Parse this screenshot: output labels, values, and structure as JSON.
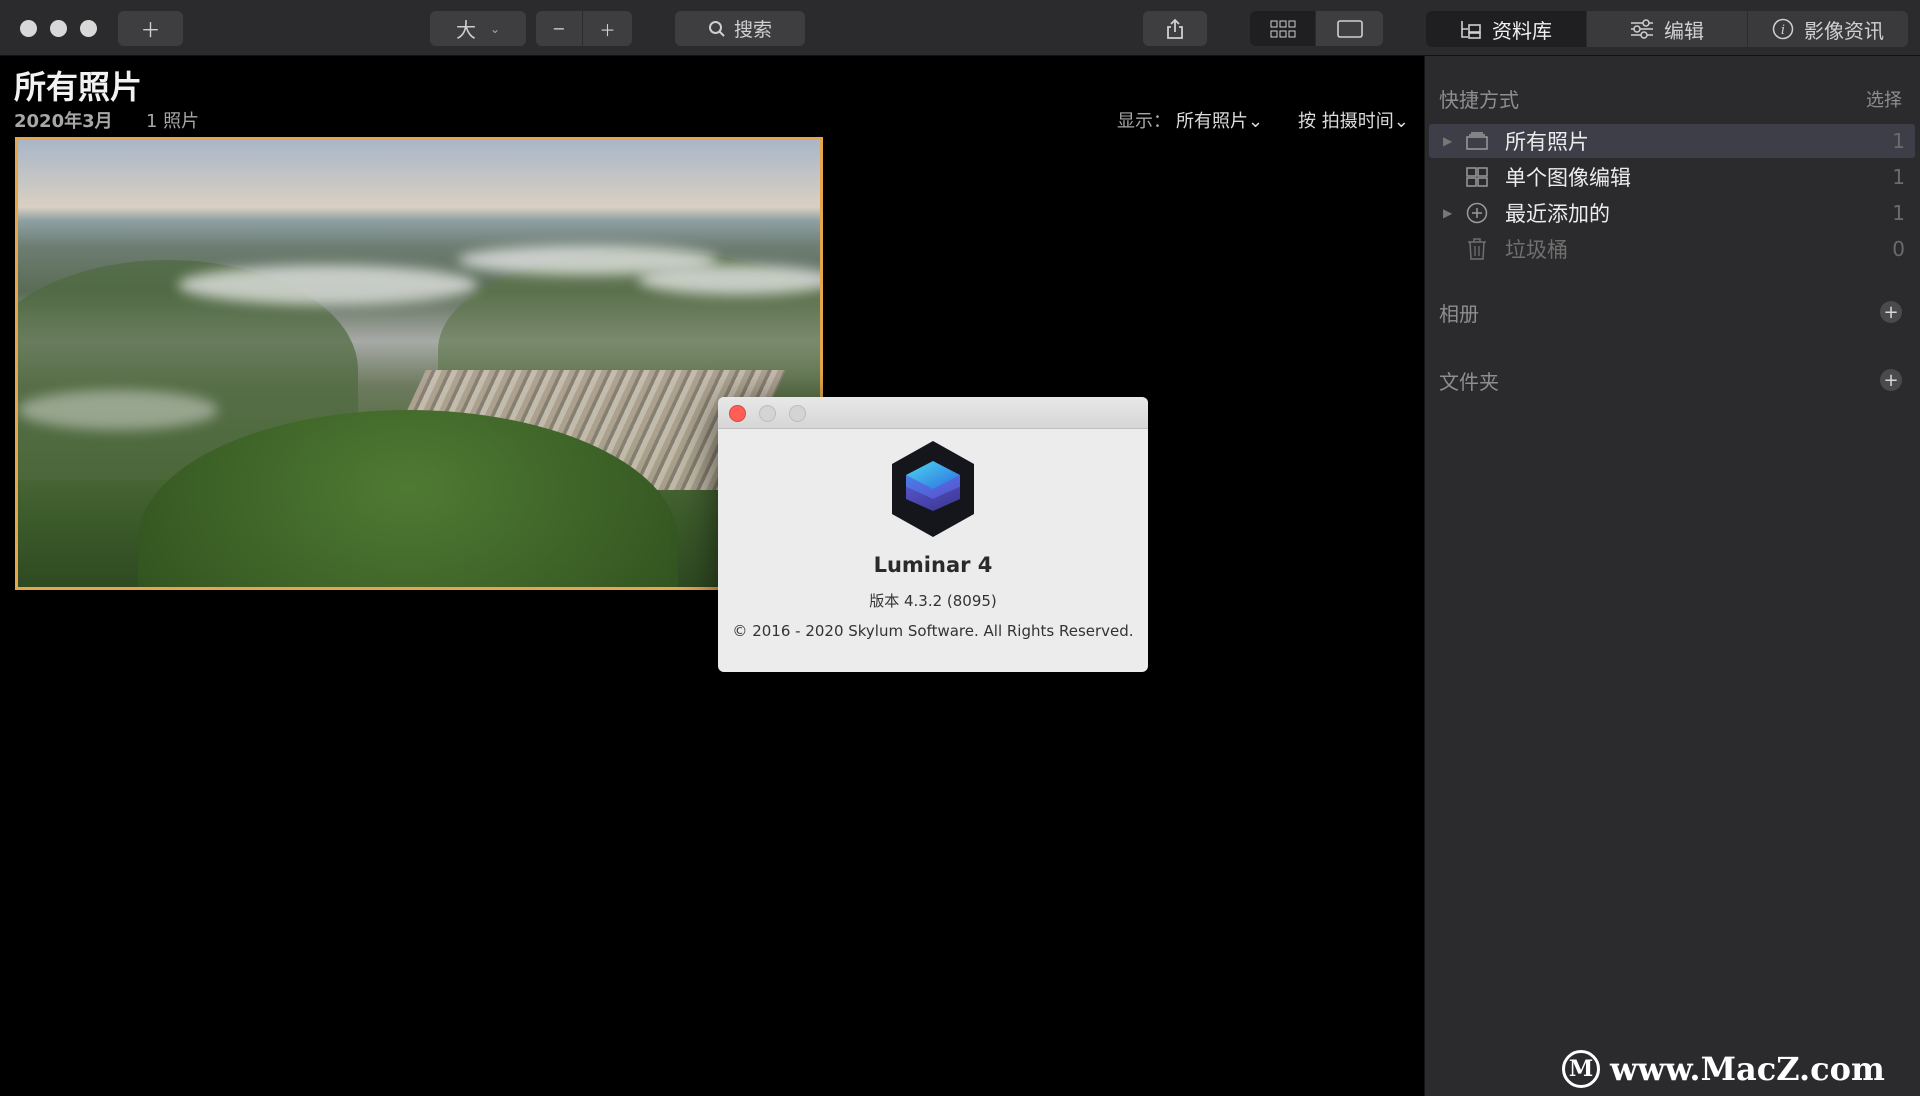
{
  "toolbar": {
    "size_label": "大",
    "search_label": "搜索",
    "tabs": [
      {
        "label": "资料库",
        "icon": "library-icon"
      },
      {
        "label": "编辑",
        "icon": "sliders-icon"
      },
      {
        "label": "影像资讯",
        "icon": "info-icon"
      }
    ]
  },
  "main": {
    "title": "所有照片",
    "date": "2020年3月",
    "count": "1 照片",
    "display_label": "显示：",
    "display_value": "所有照片⌄",
    "sort_value": "按 拍摄时间⌄"
  },
  "sidebar": {
    "shortcuts_title": "快捷方式",
    "select_label": "选择",
    "items": [
      {
        "label": "所有照片",
        "count": "1",
        "icon": "photos-stack-icon"
      },
      {
        "label": "单个图像编辑",
        "count": "1",
        "icon": "grid-icon"
      },
      {
        "label": "最近添加的",
        "count": "1",
        "icon": "add-circle-icon"
      },
      {
        "label": "垃圾桶",
        "count": "0",
        "icon": "trash-icon"
      }
    ],
    "albums_title": "相册",
    "folders_title": "文件夹"
  },
  "about": {
    "app_name": "Luminar 4",
    "version": "版本 4.3.2 (8095)",
    "copyright": "© 2016 - 2020 Skylum Software. All Rights Reserved."
  },
  "watermark": {
    "text": "www.MacZ.com"
  },
  "colors": {
    "selection_border": "#e8a64b",
    "sidebar_bg": "#2b2b2d",
    "close_red": "#ff5f57"
  }
}
